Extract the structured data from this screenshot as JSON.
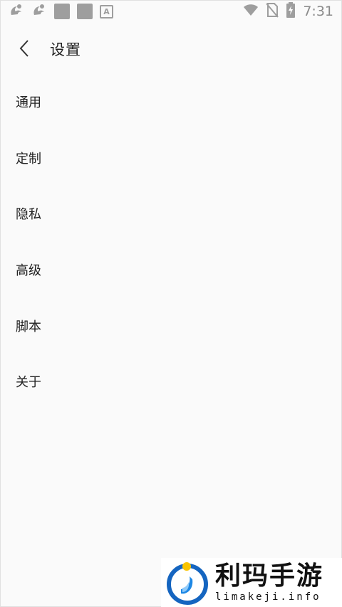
{
  "status_bar": {
    "time": "7:31",
    "icons_left": [
      "uc-browser-icon",
      "uc-browser-icon",
      "app-square-icon",
      "app-square-icon",
      "a-notification-icon"
    ],
    "icons_right": [
      "wifi-icon",
      "no-sim-icon",
      "battery-charging-icon"
    ],
    "a_badge": "A"
  },
  "toolbar": {
    "title": "设置",
    "back_icon": "chevron-left-icon"
  },
  "menu": {
    "items": [
      {
        "label": "通用"
      },
      {
        "label": "定制"
      },
      {
        "label": "隐私"
      },
      {
        "label": "高级"
      },
      {
        "label": "脚本"
      },
      {
        "label": "关于"
      }
    ]
  },
  "watermark": {
    "name": "利玛手游",
    "url": "limakeji.info"
  },
  "colors": {
    "background": "#fafafa",
    "text": "#222222",
    "status_icons": "#9e9e9e",
    "logo_blue": "#1565c0",
    "logo_yellow": "#f9c400"
  }
}
